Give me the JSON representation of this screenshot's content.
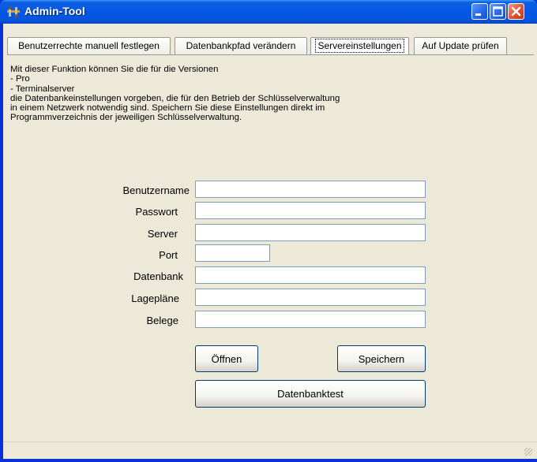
{
  "window": {
    "title": "Admin-Tool",
    "icon": "admin-tool-app-icon"
  },
  "tabs": [
    {
      "label": "Benutzerrechte manuell festlegen",
      "active": false
    },
    {
      "label": "Datenbankpfad verändern",
      "active": false
    },
    {
      "label": "Servereinstellungen",
      "active": true
    },
    {
      "label": "Auf Update prüfen",
      "active": false
    }
  ],
  "description": "Mit dieser Funktion können Sie die für die Versionen\n- Pro\n- Terminalserver\ndie Datenbankeinstellungen vorgeben, die für den Betrieb der Schlüsselverwaltung\nin einem Netzwerk notwendig sind. Speichern Sie diese Einstellungen direkt im\nProgrammverzeichnis der jeweiligen Schlüsselverwaltung.",
  "form": {
    "benutzername": {
      "label": "Benutzername",
      "value": ""
    },
    "passwort": {
      "label": "Passwort",
      "value": ""
    },
    "server": {
      "label": "Server",
      "value": ""
    },
    "port": {
      "label": "Port",
      "value": ""
    },
    "datenbank": {
      "label": "Datenbank",
      "value": ""
    },
    "lageplaene": {
      "label": "Lagepläne",
      "value": ""
    },
    "belege": {
      "label": "Belege",
      "value": ""
    }
  },
  "buttons": {
    "open": "Öffnen",
    "save": "Speichern",
    "dbtest": "Datenbanktest"
  }
}
